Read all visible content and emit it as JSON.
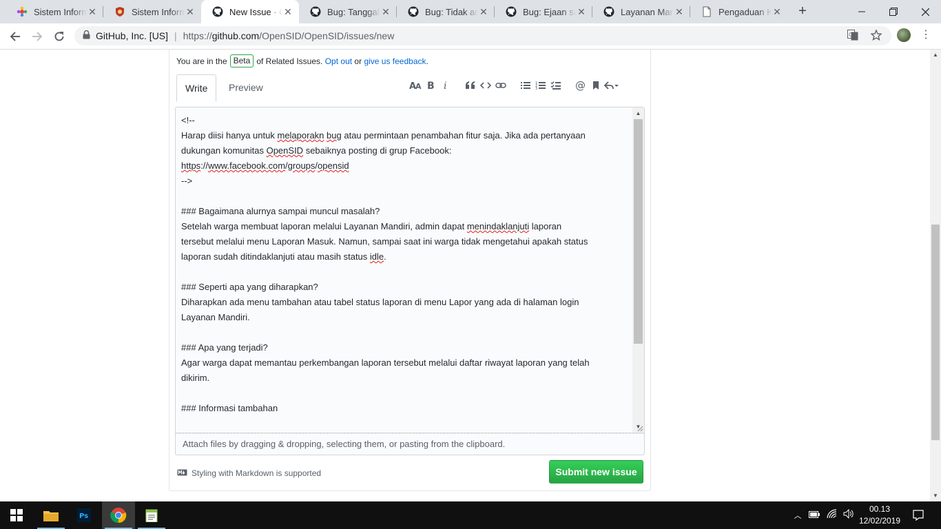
{
  "browser": {
    "tabs": [
      {
        "title": "Sistem Informa",
        "icon": "sid-favicon"
      },
      {
        "title": "Sistem Informa",
        "icon": "shield-favicon"
      },
      {
        "title": "New Issue · Op",
        "icon": "github-icon",
        "active": true
      },
      {
        "title": "Bug: Tanggal d",
        "icon": "github-icon"
      },
      {
        "title": "Bug: Tidak ada",
        "icon": "github-icon"
      },
      {
        "title": "Bug: Ejaan sala",
        "icon": "github-icon"
      },
      {
        "title": "Layanan Mand",
        "icon": "github-icon"
      },
      {
        "title": "Pengaduan Ka",
        "icon": "page-icon"
      }
    ],
    "address": {
      "origin_label": "GitHub, Inc. [US]",
      "url_prefix": "https://",
      "url_host": "github.com",
      "url_path": "/OpenSID/OpenSID/issues/new"
    }
  },
  "page": {
    "beta_prefix": "You are in the",
    "beta_badge": "Beta",
    "beta_middle": "of Related Issues.",
    "opt_out": "Opt out",
    "or": "or",
    "feedback": "give us feedback",
    "period": ".",
    "write_tab": "Write",
    "preview_tab": "Preview",
    "editor_lines": [
      "<!--",
      "Harap diisi hanya untuk §melaporakn§ §bug§ atau permintaan penambahan fitur saja. Jika ada pertanyaan",
      "dukungan komunitas §OpenSID§ sebaiknya posting di grup Facebook:",
      "§https§://§www.facebook.com§/§groups§/§opensid§",
      "-->",
      "",
      "### Bagaimana alurnya sampai muncul masalah?",
      "Setelah warga membuat laporan melalui Layanan Mandiri, admin dapat §menindaklanjuti§ laporan",
      "tersebut melalui menu Laporan Masuk. Namun, sampai saat ini warga tidak mengetahui apakah status",
      "laporan sudah ditindaklanjuti atau masih status §idle§.",
      "",
      "### Seperti apa yang diharapkan?",
      "Diharapkan ada menu tambahan atau tabel status laporan di menu Lapor yang ada di halaman login",
      "Layanan Mandiri.",
      "",
      "### Apa yang terjadi?",
      "Agar warga dapat memantau perkembangan laporan tersebut melalui daftar riwayat laporan yang telah",
      "dikirim.",
      "",
      "### Informasi tambahan"
    ],
    "attach_text": "Attach files by dragging & dropping, selecting them, or pasting from the clipboard.",
    "markdown_note": "Styling with Markdown is supported",
    "submit_label": "Submit new issue"
  },
  "taskbar": {
    "time": "00.13",
    "date": "12/02/2019"
  },
  "colors": {
    "submit_green": "#28a745",
    "link_blue": "#0366d6",
    "spell_red": "#e0201b"
  }
}
